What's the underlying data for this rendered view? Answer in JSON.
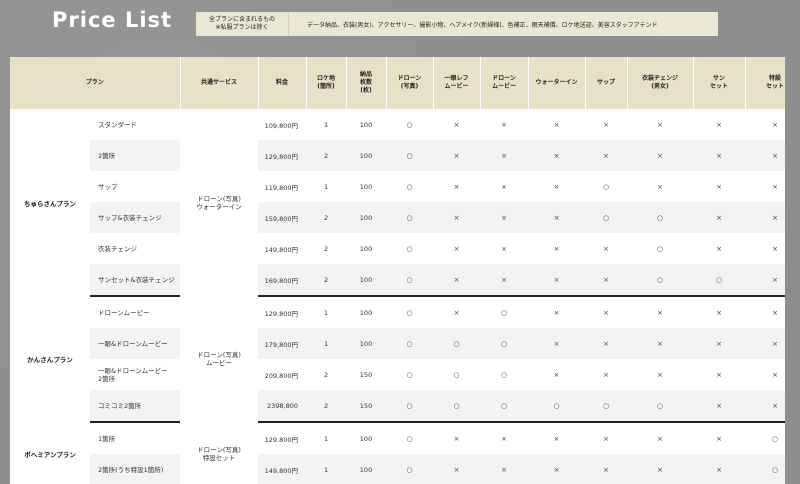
{
  "title": "Price List",
  "note": {
    "label_line1": "全プランに含まれるもの",
    "label_line2": "※私服プランは除く",
    "text": "データ納品、衣装(男女)、アクセサリー、撮影小物、ヘアメイク(新婦様)、色補正、雨天補償、ロケ地送迎、美容スタッフアテンド"
  },
  "headers": [
    "プラン",
    "共通サービス",
    "料金",
    "ロケ地\n(箇所)",
    "納品\n枚数\n(枚)",
    "ドローン\n(写真)",
    "一眼レフ\nムービー",
    "ドローン\nムービー",
    "ウォーターイン",
    "サップ",
    "衣装チェンジ\n(男女)",
    "サン\nセット",
    "特設\nセット"
  ],
  "groups": [
    {
      "name": "ちゅらさんプラン",
      "service": "ドローン(写真)\nウォーターイン",
      "rows": [
        {
          "sub": "スタンダード",
          "price": "109,800円",
          "loc": "1",
          "qty": "100",
          "marks": [
            "○",
            "×",
            "×",
            "×",
            "×",
            "×",
            "×",
            "×"
          ]
        },
        {
          "sub": "2箇所",
          "price": "129,800円",
          "loc": "2",
          "qty": "100",
          "marks": [
            "○",
            "×",
            "×",
            "×",
            "×",
            "×",
            "×",
            "×"
          ]
        },
        {
          "sub": "サップ",
          "price": "119,800円",
          "loc": "1",
          "qty": "100",
          "marks": [
            "○",
            "×",
            "×",
            "×",
            "○",
            "×",
            "×",
            "×"
          ]
        },
        {
          "sub": "サップ&衣装チェンジ",
          "price": "159,800円",
          "loc": "2",
          "qty": "100",
          "marks": [
            "○",
            "×",
            "×",
            "×",
            "○",
            "○",
            "×",
            "×"
          ]
        },
        {
          "sub": "衣装チェンジ",
          "price": "149,800円",
          "loc": "2",
          "qty": "100",
          "marks": [
            "○",
            "×",
            "×",
            "×",
            "×",
            "○",
            "×",
            "×"
          ]
        },
        {
          "sub": "サンセット&衣装チェンジ",
          "price": "169,800円",
          "loc": "2",
          "qty": "100",
          "marks": [
            "○",
            "×",
            "×",
            "×",
            "×",
            "○",
            "○",
            "×"
          ]
        }
      ]
    },
    {
      "name": "かんさんプラン",
      "service": "ドローン(写真)\nムービー",
      "rows": [
        {
          "sub": "ドローンムービー",
          "price": "129,800円",
          "loc": "1",
          "qty": "100",
          "marks": [
            "○",
            "×",
            "○",
            "×",
            "×",
            "×",
            "×",
            "×"
          ]
        },
        {
          "sub": "一眼&ドローンムービー",
          "price": "179,800円",
          "loc": "1",
          "qty": "100",
          "marks": [
            "○",
            "○",
            "○",
            "×",
            "×",
            "×",
            "×",
            "×"
          ]
        },
        {
          "sub": "一眼&ドローンムービー\n2箇所",
          "price": "209,800円",
          "loc": "2",
          "qty": "150",
          "marks": [
            "○",
            "○",
            "○",
            "×",
            "×",
            "×",
            "×",
            "×"
          ]
        },
        {
          "sub": "コミコミ2箇所",
          "price": "2398,800",
          "loc": "2",
          "qty": "150",
          "marks": [
            "○",
            "○",
            "○",
            "○",
            "○",
            "○",
            "×",
            "×"
          ]
        }
      ]
    },
    {
      "name": "ボヘミアンプラン",
      "service": "ドローン(写真)\n特設セット",
      "rows": [
        {
          "sub": "1箇所",
          "price": "129,800円",
          "loc": "1",
          "qty": "100",
          "marks": [
            "○",
            "×",
            "×",
            "×",
            "×",
            "×",
            "×",
            "○"
          ]
        },
        {
          "sub": "2箇所(うち特設1箇所)",
          "price": "149,800円",
          "loc": "1",
          "qty": "100",
          "marks": [
            "○",
            "×",
            "×",
            "×",
            "×",
            "×",
            "×",
            "○"
          ]
        }
      ]
    }
  ]
}
